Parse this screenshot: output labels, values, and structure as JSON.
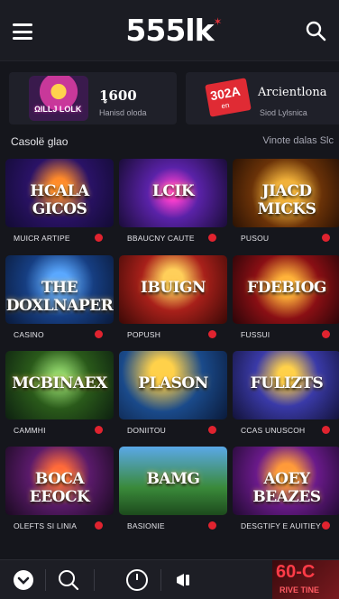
{
  "header": {
    "logo": "555lk",
    "logo_mark": "✶"
  },
  "promos": [
    {
      "art_text": "ΩILLJ LOLK",
      "title": "1̥600",
      "subtitle": "Hanisd oloda"
    },
    {
      "badge": "302A",
      "badge_sub": "en",
      "title": "Arcientlona",
      "subtitle": "Siod Lylsnica"
    }
  ],
  "section": {
    "title": "Casolë glao",
    "link": "Vinote dalas Slc"
  },
  "games": [
    {
      "thumb_title": "HCALA GICOS",
      "label": "MUICR ARTIPE"
    },
    {
      "thumb_title": "LCIK",
      "label": "BBAUCNY CAUTE"
    },
    {
      "thumb_title": "JIACD MICKS",
      "label": "PUSOU"
    },
    {
      "thumb_title": "THE DOXLNAPER",
      "label": "CASINO"
    },
    {
      "thumb_title": "IBUIGN",
      "label": "POPUSH"
    },
    {
      "thumb_title": "FDEBIOG",
      "label": "FUSSUI"
    },
    {
      "thumb_title": "MCBINAEX",
      "label": "CAMMHI"
    },
    {
      "thumb_title": "PLASON",
      "label": "DONIITOU"
    },
    {
      "thumb_title": "FULIZTS",
      "label": "CCAS UNUSCOH"
    },
    {
      "thumb_title": "BOCA EEOCK",
      "label": "OLEFTS SI LINIA"
    },
    {
      "thumb_title": "BAMG",
      "label": "BASIONIE"
    },
    {
      "thumb_title": "AOEY BEAZES",
      "label": "DESGTIFY E AUITIEY"
    }
  ],
  "bottom": {
    "corner_main": "60-C",
    "corner_sub": "RIVE TINE"
  },
  "colors": {
    "accent": "#e0232f",
    "background": "#15161c",
    "bar": "#1b1c23"
  }
}
